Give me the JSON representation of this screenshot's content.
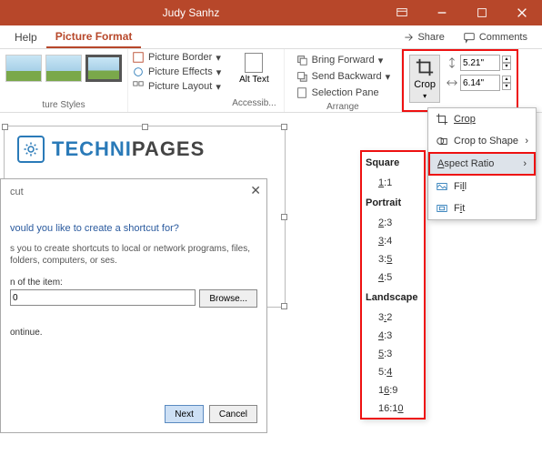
{
  "title": "Judy Sanhz",
  "menu": {
    "help": "Help",
    "pictureFormat": "Picture Format",
    "share": "Share",
    "comments": "Comments"
  },
  "ribbon": {
    "stylesLabel": "ture Styles",
    "border": "Picture Border",
    "effects": "Picture Effects",
    "layout": "Picture Layout",
    "altText": "Alt Text",
    "accessLabel": "Accessib...",
    "bringForward": "Bring Forward",
    "sendBackward": "Send Backward",
    "selectionPane": "Selection Pane",
    "arrangeLabel": "Arrange",
    "crop": "Crop",
    "height": "5.21\"",
    "width": "6.14\""
  },
  "cropMenu": {
    "crop": "Crop",
    "cropToShape": "Crop to Shape",
    "aspectRatio": "Aspect Ratio",
    "fill": "Fill",
    "fit": "Fit"
  },
  "aspect": {
    "square": "Square",
    "r11": "1:1",
    "portrait": "Portrait",
    "r23": "2:3",
    "r34": "3:4",
    "r35": "3:5",
    "r45": "4:5",
    "landscape": "Landscape",
    "r32": "3:2",
    "r43": "4:3",
    "r53": "5:3",
    "r54": "5:4",
    "r169": "16:9",
    "r1610": "16:10"
  },
  "logo": {
    "part1": "TECHNI",
    "part2": "PAGES"
  },
  "dialog": {
    "cut": "cut",
    "question": "vould you like to create a shortcut for?",
    "desc": "s you to create shortcuts to local or network programs, files, folders, computers, or ses.",
    "locLabel": "n of the item:",
    "locValue": "0",
    "browse": "Browse...",
    "continue": "ontinue.",
    "next": "Next",
    "cancel": "Cancel"
  }
}
